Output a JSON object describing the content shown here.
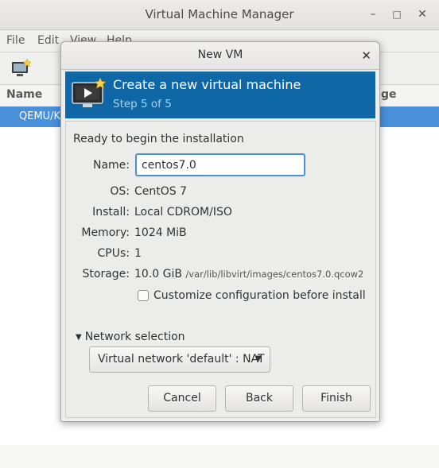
{
  "main_window": {
    "title": "Virtual Machine Manager",
    "menu": [
      "File",
      "Edit",
      "View",
      "Help"
    ],
    "list_header": {
      "name": "Name",
      "right_column_fragment": "ge"
    },
    "list_rows": [
      {
        "label": "QEMU/KV"
      }
    ],
    "window_buttons": [
      "minimize-icon",
      "maximize-icon",
      "close-icon"
    ]
  },
  "dialog": {
    "title": "New VM",
    "close_icon": "close-icon",
    "banner": {
      "title": "Create a new virtual machine",
      "subtitle": "Step 5 of 5",
      "icon": "monitor-new-icon"
    },
    "ready_text": "Ready to begin the installation",
    "fields": {
      "name_label": "Name:",
      "name_value": "centos7.0",
      "os_label": "OS:",
      "os_value": "CentOS 7",
      "install_label": "Install:",
      "install_value": "Local CDROM/ISO",
      "memory_label": "Memory:",
      "memory_value": "1024 MiB",
      "cpus_label": "CPUs:",
      "cpus_value": "1",
      "storage_label": "Storage:",
      "storage_value": "10.0 GiB",
      "storage_path": "/var/lib/libvirt/images/centos7.0.qcow2"
    },
    "customize_checkbox": {
      "label": "Customize configuration before install",
      "checked": false
    },
    "network": {
      "expander_label": "Network selection",
      "selected": "Virtual network 'default' : NAT"
    },
    "buttons": {
      "cancel": "Cancel",
      "back": "Back",
      "finish": "Finish"
    }
  },
  "colors": {
    "banner_bg": "#0f67a6",
    "selection": "#4a90d9",
    "subtitle": "#a6d3f5"
  }
}
